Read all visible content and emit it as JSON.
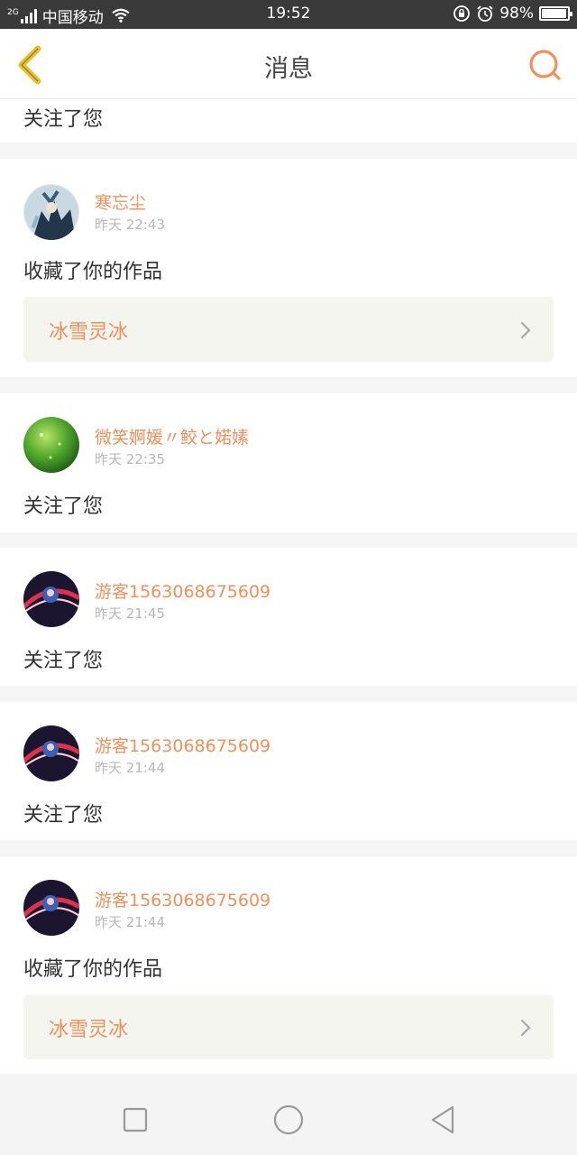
{
  "status_bar": {
    "network": "2G",
    "carrier": "中国移动",
    "time": "19:52",
    "battery": "98%",
    "battery_level": 0.98
  },
  "header": {
    "title": "消息",
    "back_icon": "chevron-left-icon",
    "search_icon": "search-icon"
  },
  "messages": [
    {
      "action": "关注了您"
    },
    {
      "username": "寒忘尘",
      "time": "昨天 22:43",
      "action": "收藏了你的作品",
      "work_title": "冰雪灵冰"
    },
    {
      "username": "微笑婀媛〃鲛と婼嫊",
      "time": "昨天 22:35",
      "action": "关注了您"
    },
    {
      "username": "游客1563068675609",
      "time": "昨天 21:45",
      "action": "关注了您"
    },
    {
      "username": "游客1563068675609",
      "time": "昨天 21:44",
      "action": "关注了您"
    },
    {
      "username": "游客1563068675609",
      "time": "昨天 21:44",
      "action": "收藏了你的作品",
      "work_title": "冰雪灵冰"
    }
  ],
  "colors": {
    "accent": "#f0905a",
    "back_icon": "#e8c22a",
    "work_bg": "#f5f5ef"
  },
  "nav": {
    "recent_icon": "square-icon",
    "home_icon": "circle-icon",
    "back_icon": "triangle-back-icon"
  }
}
